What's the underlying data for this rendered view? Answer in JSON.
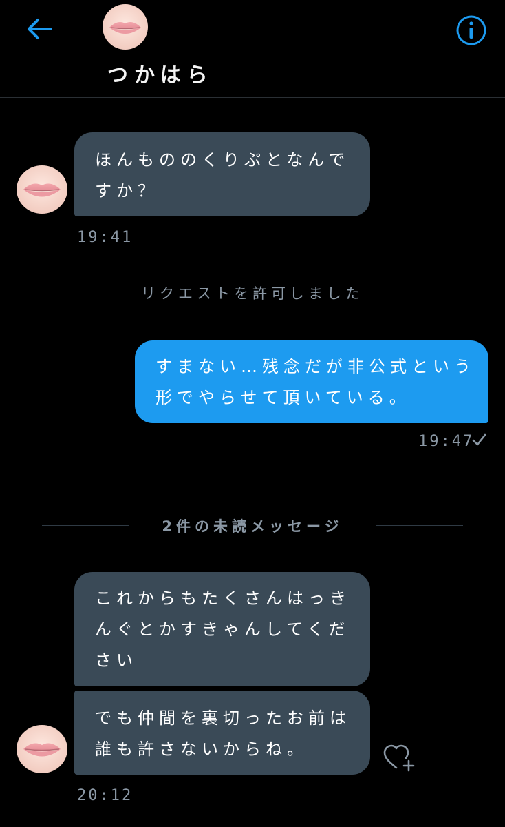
{
  "header": {
    "name": "つかはら",
    "back_icon": "arrow-left-icon",
    "info_icon": "info-icon",
    "accent_color": "#1d9bf0"
  },
  "messages": [
    {
      "text": "ほんもののくりぷとなんですか？",
      "time": "19:41"
    },
    {
      "system": "リクエストを許可しました"
    },
    {
      "text": "すまない…残念だが非公式という形でやらせて頂いている。",
      "time": "19:47",
      "status_icon": "check-icon"
    },
    {
      "divider": "2件の未読メッセージ"
    },
    {
      "text": "これからもたくさんはっきんぐとかすきゃんしてください"
    },
    {
      "text": "でも仲間を裏切ったお前は誰も許さないからね。",
      "time": "20:12",
      "reaction_icon": "heart-plus-icon"
    }
  ],
  "colors": {
    "incoming_bubble": "#3a4a57",
    "outgoing_bubble": "#1d9bf0",
    "muted_text": "#8b98a5"
  }
}
